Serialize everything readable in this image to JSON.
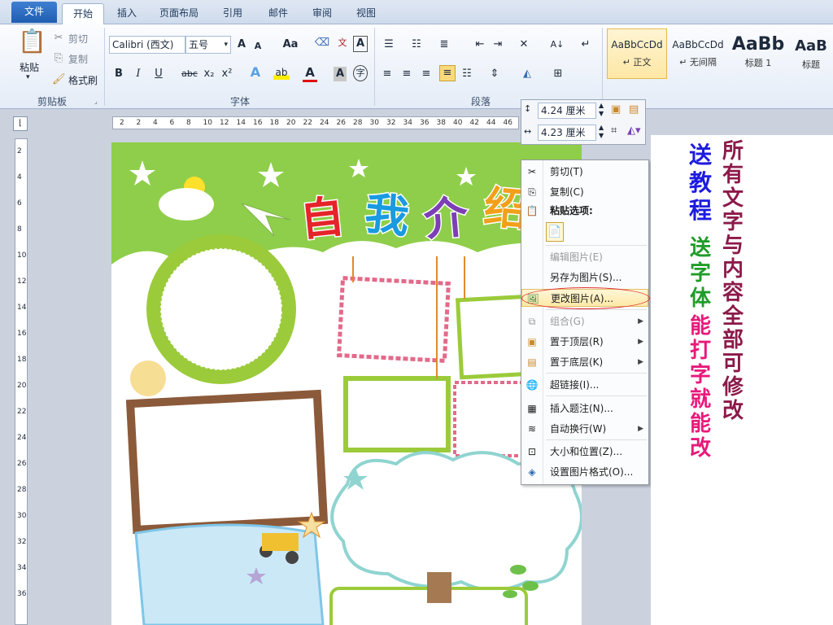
{
  "tabs": [
    "文件",
    "开始",
    "插入",
    "页面布局",
    "引用",
    "邮件",
    "审阅",
    "视图"
  ],
  "clipboard": {
    "paste": "粘贴",
    "cut": "剪切",
    "copy": "复制",
    "format_painter": "格式刷",
    "group": "剪贴板"
  },
  "font": {
    "name": "Calibri (西文)",
    "size": "五号",
    "group": "字体",
    "a_grow": "A",
    "a_shrink": "A",
    "case": "Aa",
    "bold": "B",
    "italic": "I",
    "underline": "U",
    "strike": "abc",
    "sub": "x₂",
    "sup": "x²"
  },
  "paragraph": {
    "group": "段落"
  },
  "styles": [
    {
      "sample": "AaBbCcDd",
      "name": "正文"
    },
    {
      "sample": "AaBbCcDd",
      "name": "无间隔"
    },
    {
      "sample": "AaBb",
      "name": "标题 1"
    },
    {
      "sample": "AaB",
      "name": "标题"
    }
  ],
  "size_panel": {
    "height": "4.24 厘米",
    "width": "4.23 厘米"
  },
  "ruler_marks": [
    "2",
    "2",
    "4",
    "6",
    "8",
    "10",
    "12",
    "14",
    "16",
    "18",
    "20",
    "22",
    "24",
    "26",
    "28",
    "30",
    "32",
    "34",
    "36",
    "38",
    "40",
    "42",
    "44",
    "46"
  ],
  "vruler_marks": [
    "2",
    "4",
    "6",
    "8",
    "10",
    "12",
    "14",
    "16",
    "18",
    "20",
    "22",
    "24",
    "26",
    "28",
    "30",
    "32",
    "34",
    "36"
  ],
  "menu": [
    {
      "label": "剪切(T)",
      "icon": "✂",
      "disabled": false
    },
    {
      "label": "复制(C)",
      "icon": "⎘",
      "disabled": false
    },
    {
      "label": "粘贴选项:",
      "icon": "📋",
      "disabled": false,
      "bold": true
    },
    {
      "label": "编辑图片(E)",
      "disabled": true
    },
    {
      "label": "另存为图片(S)...",
      "disabled": false
    },
    {
      "label": "更改图片(A)...",
      "icon": "🖼",
      "disabled": false,
      "highlight": true
    },
    {
      "label": "组合(G)",
      "icon": "⧉",
      "disabled": true,
      "submenu": true
    },
    {
      "label": "置于顶层(R)",
      "icon": "▣",
      "disabled": false,
      "submenu": true
    },
    {
      "label": "置于底层(K)",
      "icon": "▤",
      "disabled": false,
      "submenu": true
    },
    {
      "label": "超链接(I)...",
      "icon": "🌐",
      "disabled": false
    },
    {
      "label": "插入题注(N)...",
      "icon": "▦",
      "disabled": false
    },
    {
      "label": "自动换行(W)",
      "icon": "≋",
      "disabled": false,
      "submenu": true
    },
    {
      "label": "大小和位置(Z)...",
      "icon": "⊡",
      "disabled": false
    },
    {
      "label": "设置图片格式(O)...",
      "icon": "◈",
      "disabled": false
    }
  ],
  "promo": {
    "col1": "送教程",
    "col1b": "送字体",
    "col2": "所有文字与内容全部可修改",
    "col3": "能打字就能改"
  },
  "doc": {
    "title": "自我介绍",
    "title_parts": [
      "自",
      "我",
      "介",
      "绍"
    ]
  },
  "colors": {
    "blue": "#1d1be0",
    "green": "#1f9c2a",
    "pink": "#e8197a",
    "maroon": "#8b1a4a",
    "page_green": "#8fce4a"
  }
}
